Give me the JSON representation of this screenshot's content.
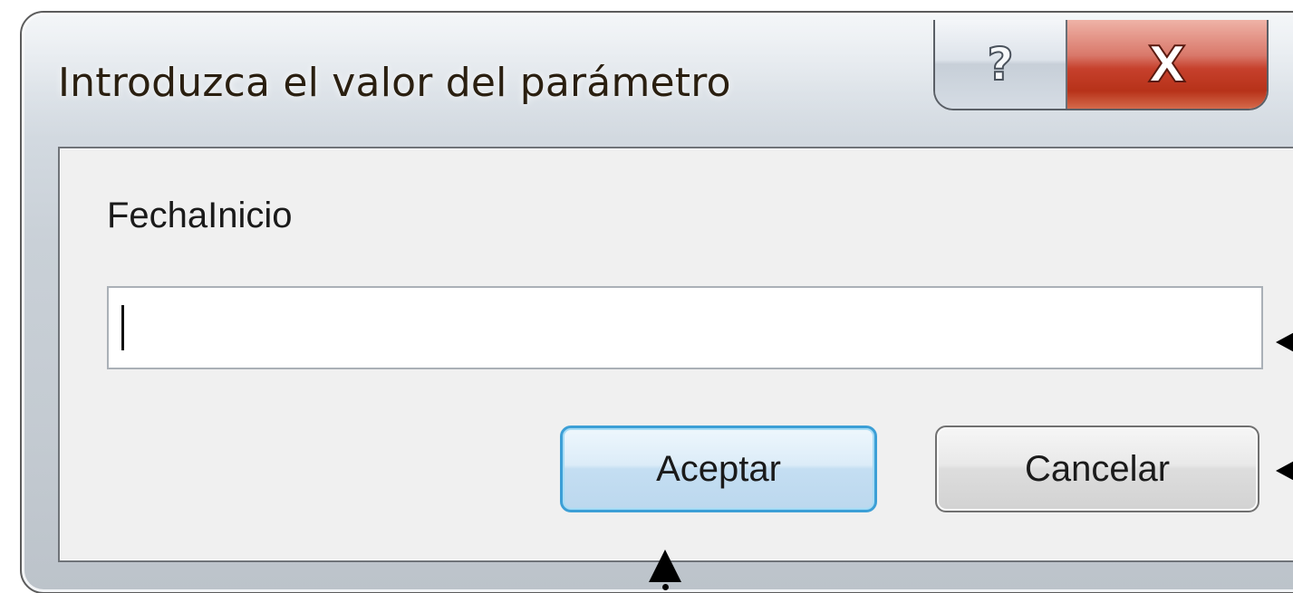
{
  "dialog": {
    "title": "Introduzca el valor del parámetro",
    "parameter_label": "FechaInicio",
    "value_input": {
      "value": "",
      "placeholder": ""
    },
    "buttons": {
      "ok_label": "Aceptar",
      "cancel_label": "Cancelar"
    },
    "caption": {
      "help_glyph": "?",
      "close_glyph": "X"
    }
  },
  "colors": {
    "ok_button_border": "#3c9fd6",
    "close_button": "#c6402c"
  }
}
